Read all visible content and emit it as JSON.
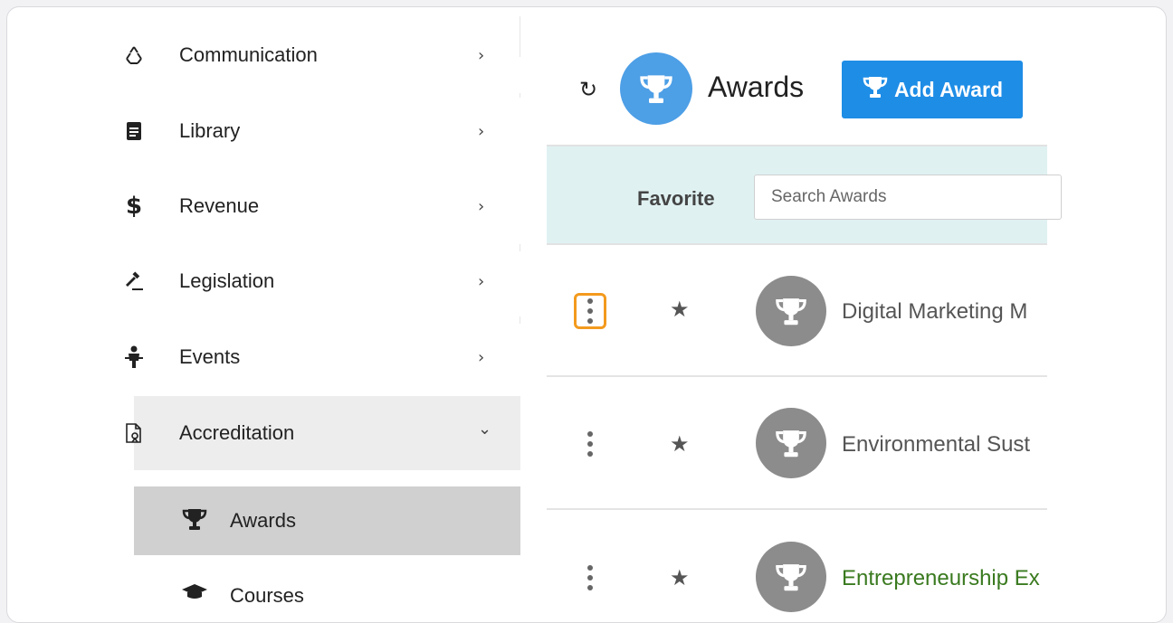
{
  "sidebar": {
    "items": [
      {
        "label": "Communication",
        "icon": "recycle-icon"
      },
      {
        "label": "Library",
        "icon": "document-icon"
      },
      {
        "label": "Revenue",
        "icon": "dollar-icon"
      },
      {
        "label": "Legislation",
        "icon": "gavel-icon"
      },
      {
        "label": "Events",
        "icon": "person-icon"
      },
      {
        "label": "Accreditation",
        "icon": "certificate-icon"
      }
    ],
    "chevron_right": "›",
    "chevron_down": "⌄",
    "sub_items": [
      {
        "label": "Awards",
        "icon": "trophy-icon"
      },
      {
        "label": "Courses",
        "icon": "graduation-cap-icon"
      }
    ]
  },
  "header": {
    "refresh_glyph": "↻",
    "title": "Awards",
    "add_button_label": "Add Award"
  },
  "filter": {
    "favorite_label": "Favorite",
    "search_placeholder": "Search Awards"
  },
  "rows": [
    {
      "name": "Digital Marketing M",
      "color": "#555555"
    },
    {
      "name": "Environmental Sust",
      "color": "#555555"
    },
    {
      "name": "Entrepreneurship Ex",
      "color": "#3a7a1f"
    }
  ],
  "star_glyph": "★",
  "colors": {
    "accent_blue": "#1e8de6",
    "avatar_blue": "#4d9fe6",
    "filter_bg": "#e0f1f2",
    "highlight_orange": "#f39a1e",
    "active_nav": "#d0d0d0"
  }
}
